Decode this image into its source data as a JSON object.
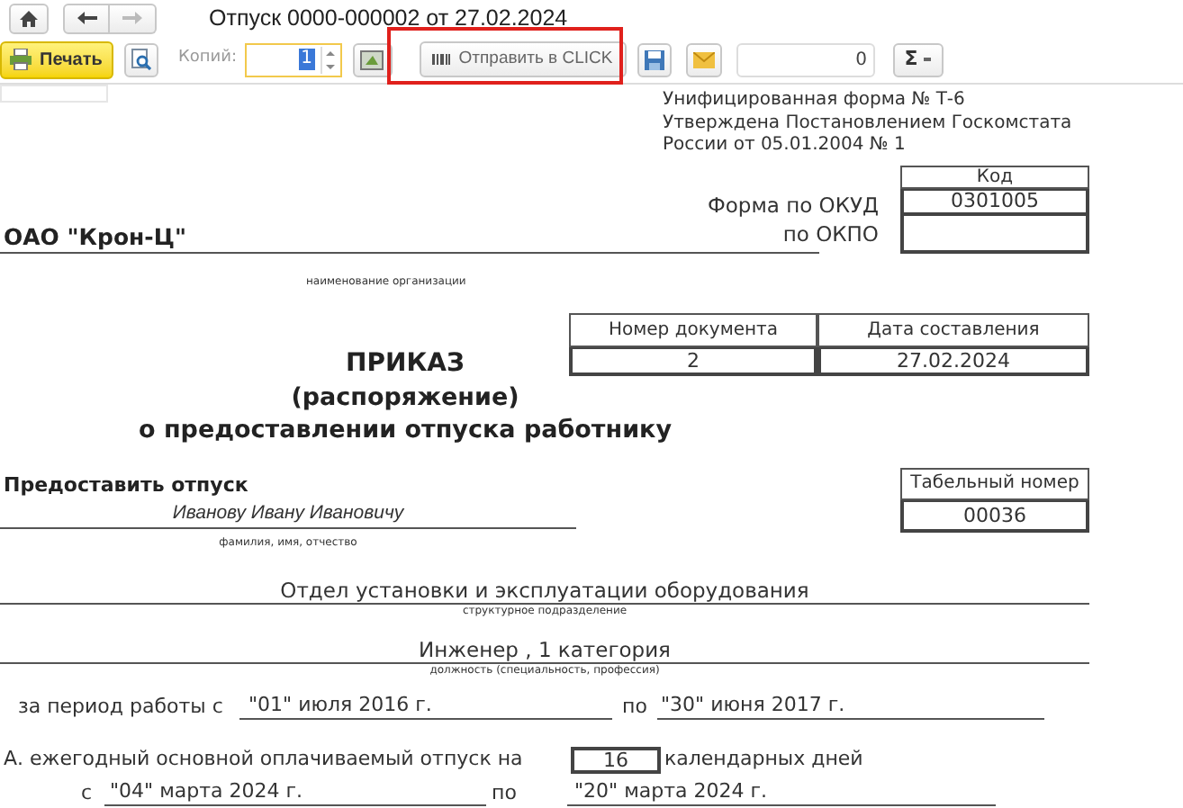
{
  "window": {
    "title": "Отпуск 0000-000002 от 27.02.2024"
  },
  "toolbar": {
    "print_button": "Печать",
    "copies_label": "Копий:",
    "copies_value": "1",
    "send_button": {
      "label": "Отправить в CLICK",
      "highlighted": true
    },
    "counter_value": "0",
    "sum_button": "Σ"
  },
  "form": {
    "header_lines": [
      "Унифицированная форма № Т-6",
      "Утверждена Постановлением Госкомстата",
      "России от 05.01.2004 № 1"
    ],
    "code_header": "Код",
    "okud_label": "Форма по ОКУД",
    "okud_code": "0301005",
    "okpo_label": "по ОКПО",
    "organization": "ОАО \"Крон-Ц\"",
    "organization_caption": "наименование организации",
    "doc_table": {
      "columns": [
        "Номер документа",
        "Дата составления"
      ],
      "values": [
        "2",
        "27.02.2024"
      ]
    },
    "title_lines": [
      "ПРИКАЗ",
      "(распоряжение)",
      "о предоставлении отпуска работнику"
    ],
    "grant_label": "Предоставить отпуск",
    "employee_name": "Иванову Ивану Ивановичу",
    "employee_caption": "фамилия, имя, отчество",
    "tab_number_label": "Табельный номер",
    "tab_number": "00036",
    "department": "Отдел установки и эксплуатации оборудования",
    "department_caption": "структурное подразделение",
    "position": "Инженер , 1 категория",
    "position_caption": "должность (специальность, профессия)",
    "period": {
      "from_label": "за период работы с",
      "from": "\"01\" июля 2016 г.",
      "to_label": "по",
      "to": "\"30\" июня 2017 г."
    },
    "leave": {
      "label": "А. ежегодный основной оплачиваемый отпуск на",
      "days": "16",
      "days_label": "календарных дней",
      "from_label": "с",
      "from": "\"04\" марта 2024 г.",
      "to_label": "по",
      "to": "\"20\" марта 2024 г."
    }
  }
}
